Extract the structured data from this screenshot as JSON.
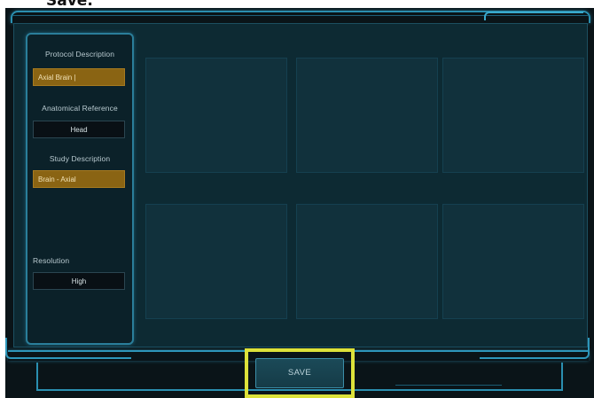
{
  "caption": {
    "text": "Save."
  },
  "left_panel": {
    "protocol": {
      "label": "Protocol Description",
      "value": "Axial Brain |"
    },
    "anatomical": {
      "label": "Anatomical Reference",
      "value": "Head"
    },
    "study": {
      "label": "Study Description",
      "value": "Brain - Axial"
    },
    "resolution": {
      "label": "Resolution",
      "value": "High"
    }
  },
  "footer": {
    "save_label": "SAVE"
  },
  "colors": {
    "background": "#0a1418",
    "panel": "#0d2a33",
    "accent_blue": "#2a8fb0",
    "field_gold": "#8a6413",
    "highlight_yellow": "#dde23a"
  }
}
